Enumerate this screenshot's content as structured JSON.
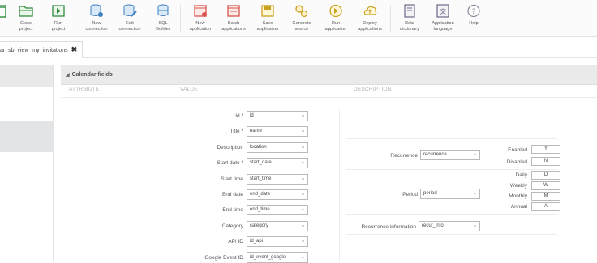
{
  "toolbar": {
    "items": [
      {
        "label": "t",
        "icon": "project-icon"
      },
      {
        "label": "Close\nproject",
        "icon": "close-project-icon"
      },
      {
        "label": "Run\nproject",
        "icon": "run-project-icon"
      },
      {
        "label": "New\nconnection",
        "icon": "new-connection-icon"
      },
      {
        "label": "Edit\nconnection",
        "icon": "edit-connection-icon"
      },
      {
        "label": "SQL\nBuilder",
        "icon": "sql-builder-icon"
      },
      {
        "label": "New\napplication",
        "icon": "new-application-icon"
      },
      {
        "label": "Batch\napplications",
        "icon": "batch-applications-icon"
      },
      {
        "label": "Save\napplication",
        "icon": "save-application-icon"
      },
      {
        "label": "Generate\nsource",
        "icon": "generate-source-icon"
      },
      {
        "label": "Run\napplication",
        "icon": "run-application-icon"
      },
      {
        "label": "Deploy\napplications",
        "icon": "deploy-applications-icon"
      },
      {
        "label": "Data\ndictionary",
        "icon": "data-dictionary-icon"
      },
      {
        "label": "Application\nlanguage",
        "icon": "application-language-icon"
      },
      {
        "label": "Help",
        "icon": "help-icon"
      }
    ]
  },
  "tab": {
    "label": "ar_sb_view_my_invitations",
    "close": "✖"
  },
  "section": {
    "title": "Calendar fields",
    "toggle": "◢"
  },
  "columns": {
    "attribute": "ATTRIBUTE",
    "value": "VALUE",
    "description": "DESCRIPTION"
  },
  "fields": [
    {
      "label": "Id *",
      "value": "id"
    },
    {
      "label": "Title *",
      "value": "name"
    },
    {
      "label": "Description",
      "value": "location"
    },
    {
      "label": "Start date *",
      "value": "start_date"
    },
    {
      "label": "Start time",
      "value": "start_time"
    },
    {
      "label": "End date",
      "value": "end_date"
    },
    {
      "label": "End time",
      "value": "end_time"
    },
    {
      "label": "Category",
      "value": "category"
    },
    {
      "label": "API ID",
      "value": "id_api"
    },
    {
      "label": "Google Event ID",
      "value": "id_event_google"
    }
  ],
  "recurrence": {
    "label": "Recurrence",
    "value": "recurrence",
    "enabled_label": "Enabled",
    "enabled_value": "Y",
    "disabled_label": "Disabled",
    "disabled_value": "N"
  },
  "period": {
    "label": "Period",
    "value": "period",
    "options": [
      {
        "label": "Daily",
        "value": "D"
      },
      {
        "label": "Weekly",
        "value": "W"
      },
      {
        "label": "Monthly",
        "value": "M"
      },
      {
        "label": "Annual",
        "value": "A"
      }
    ]
  },
  "recurrence_info": {
    "label": "Recurrence information",
    "value": "recur_info"
  },
  "chevron": "⌄",
  "colors": {
    "accent": "#3c7fc0",
    "header_bg": "#eaeaeb",
    "border": "#b9b9b9"
  }
}
